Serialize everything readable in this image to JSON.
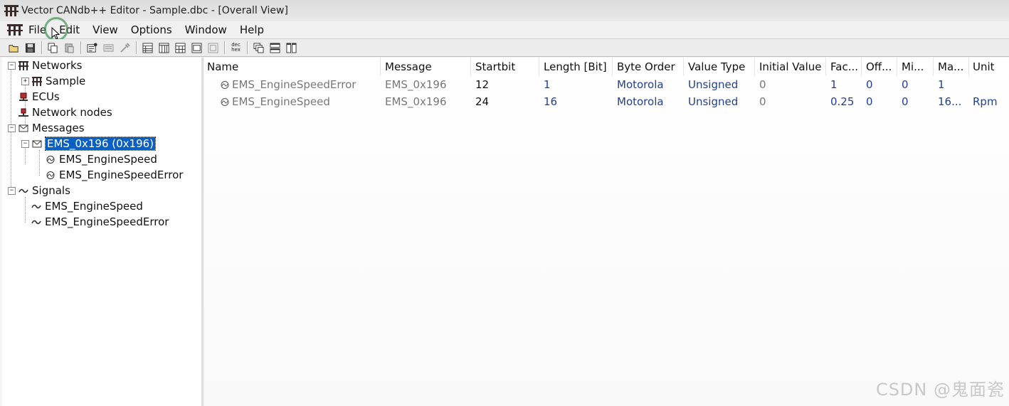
{
  "window": {
    "title": "Vector CANdb++ Editor - Sample.dbc - [Overall View]"
  },
  "menu": [
    "File",
    "Edit",
    "View",
    "Options",
    "Window",
    "Help"
  ],
  "tree": {
    "networks": "Networks",
    "sample": "Sample",
    "ecus": "ECUs",
    "network_nodes": "Network nodes",
    "messages": "Messages",
    "message_selected": "EMS_0x196 (0x196)",
    "msg_signal_1": "EMS_EngineSpeed",
    "msg_signal_2": "EMS_EngineSpeedError",
    "signals": "Signals",
    "signal_1": "EMS_EngineSpeed",
    "signal_2": "EMS_EngineSpeedError"
  },
  "table": {
    "columns": [
      "Name",
      "Message",
      "Startbit",
      "Length [Bit]",
      "Byte Order",
      "Value Type",
      "Initial Value",
      "Fac...",
      "Off...",
      "Mi...",
      "Ma...",
      "Unit"
    ],
    "rows": [
      [
        "EMS_EngineSpeedError",
        "EMS_0x196",
        "12",
        "1",
        "Motorola",
        "Unsigned",
        "0",
        "1",
        "0",
        "0",
        "1",
        ""
      ],
      [
        "EMS_EngineSpeed",
        "EMS_0x196",
        "24",
        "16",
        "Motorola",
        "Unsigned",
        "0",
        "0.25",
        "0",
        "0",
        "16...",
        "Rpm"
      ]
    ]
  },
  "watermark": "CSDN @鬼面瓷",
  "colors": {
    "selection": "#0a5fc2",
    "blue_value": "#1f3f98",
    "grey_value": "#777777"
  }
}
